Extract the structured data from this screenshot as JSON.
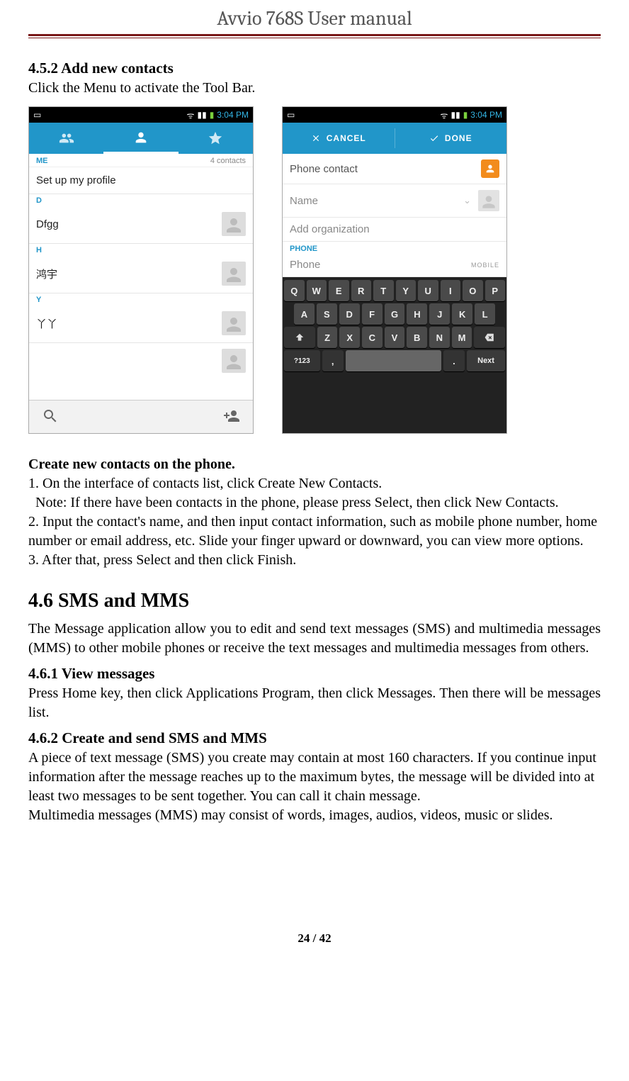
{
  "header": {
    "title_prefix": "Avvio 768S",
    "title_suffix": " User manual"
  },
  "section_452": {
    "heading": "4.5.2 Add new contacts",
    "intro": "Click the Menu to activate the Tool Bar."
  },
  "contacts_shot": {
    "status_time": "3:04 PM",
    "me_label": "ME",
    "contacts_count": "4 contacts",
    "profile_row": "Set up my profile",
    "sec_d": "D",
    "row_d": "Dfgg",
    "sec_h": "H",
    "row_h": "鸿宇",
    "sec_y": "Y",
    "row_y": "丫丫"
  },
  "newcontact_shot": {
    "status_time": "3:04 PM",
    "cancel": "CANCEL",
    "done": "DONE",
    "phone_contact": "Phone contact",
    "name": "Name",
    "add_org": "Add organization",
    "phone_section": "PHONE",
    "phone_placeholder": "Phone",
    "mobile_tag": "MOBILE",
    "kbd_row1": [
      "Q",
      "W",
      "E",
      "R",
      "T",
      "Y",
      "U",
      "I",
      "O",
      "P"
    ],
    "kbd_row2": [
      "A",
      "S",
      "D",
      "F",
      "G",
      "H",
      "J",
      "K",
      "L"
    ],
    "kbd_row3_mid": [
      "Z",
      "X",
      "C",
      "V",
      "B",
      "N",
      "M"
    ],
    "sym_key": "?123",
    "comma_key": ",",
    "period_key": ".",
    "next_key": "Next"
  },
  "create_contacts": {
    "heading": "Create new contacts on the phone.",
    "line1": "1. On the interface of contacts list, click Create New Contacts.",
    "note": "  Note: If there have been contacts in the phone, please press Select, then click New Contacts.",
    "line2": "2. Input the contact's name, and then input contact information, such as mobile phone number, home number or email address, etc. Slide your finger upward or downward, you can view more options.",
    "line3": "3. After that, press Select and then click Finish."
  },
  "section_46": {
    "heading": "4.6 SMS and MMS",
    "para": "The Message application allow you to edit and send text messages (SMS) and multimedia messages (MMS) to other mobile phones or receive the text messages and multimedia messages from others."
  },
  "section_461": {
    "heading": "4.6.1 View messages",
    "para": "Press Home key, then click Applications Program, then click Messages. Then there will be messages list."
  },
  "section_462": {
    "heading": "4.6.2 Create and send SMS and MMS",
    "para1": "A piece of text message (SMS) you create may contain at most 160 characters.  If you continue input information after the message reaches up to the maximum bytes, the message will be divided into at least two messages to be sent together. You can call it chain message.",
    "para2": "Multimedia messages (MMS) may consist of words, images, audios, videos, music or slides."
  },
  "footer": {
    "page": "24 / 42"
  }
}
